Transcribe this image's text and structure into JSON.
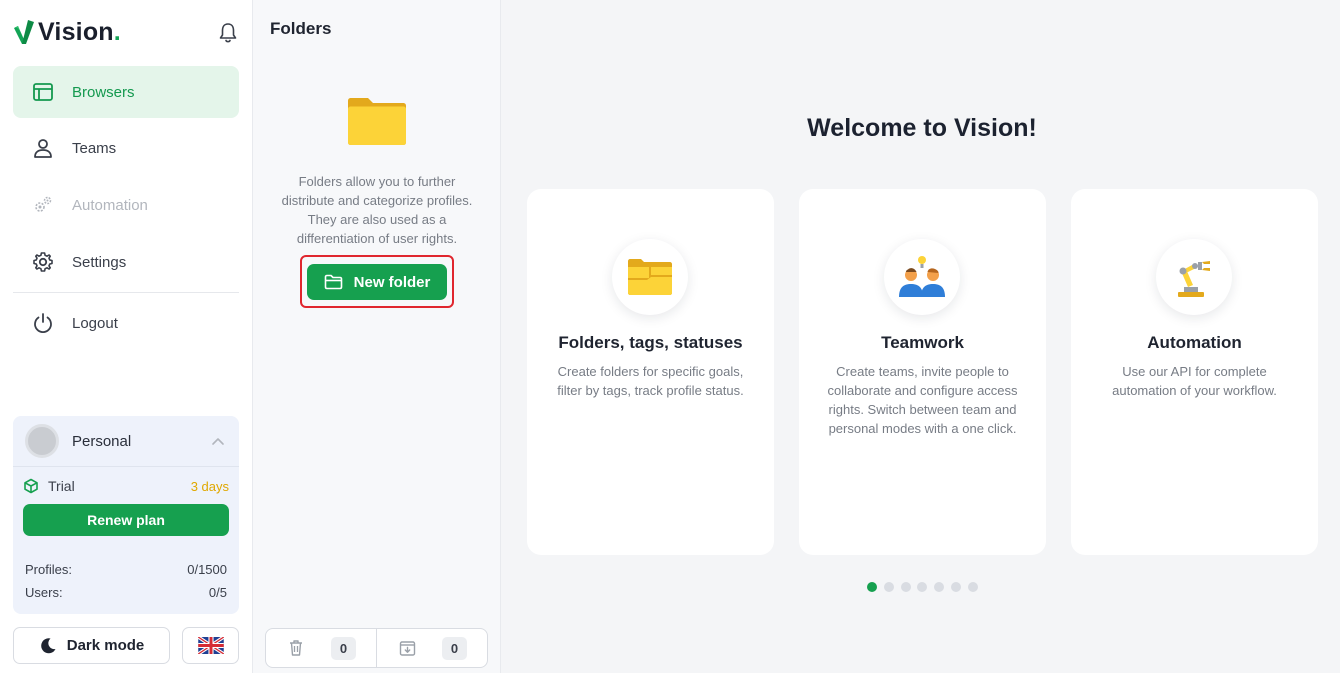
{
  "brand": {
    "name": "Vision",
    "dot": "."
  },
  "sidebar": {
    "items": [
      {
        "label": "Browsers",
        "icon": "browser-window-icon",
        "active": true
      },
      {
        "label": "Teams",
        "icon": "user-icon"
      },
      {
        "label": "Automation",
        "icon": "gears-icon",
        "disabled": true
      },
      {
        "label": "Settings",
        "icon": "gear-icon"
      },
      {
        "label": "Logout",
        "icon": "power-icon"
      }
    ]
  },
  "account": {
    "name": "Personal",
    "plan_label": "Trial",
    "plan_remaining": "3 days",
    "renew_label": "Renew plan",
    "profiles_label": "Profiles:",
    "profiles_value": "0/1500",
    "users_label": "Users:",
    "users_value": "0/5"
  },
  "footer": {
    "dark_mode_label": "Dark mode",
    "language_icon": "uk-flag-icon"
  },
  "folders": {
    "title": "Folders",
    "description": "Folders allow you to further distribute and categorize profiles. They are also used as a differentiation of user rights.",
    "new_folder_label": "New folder",
    "trash_count": "0",
    "archive_count": "0"
  },
  "main": {
    "welcome": "Welcome to Vision!",
    "cards": [
      {
        "title": "Folders, tags, statuses",
        "text": "Create folders for specific goals, filter by tags, track profile status.",
        "icon": "folders-icon"
      },
      {
        "title": "Teamwork",
        "text": "Create teams, invite people to collaborate and configure access rights. Switch between team and personal modes with a one click.",
        "icon": "team-icon"
      },
      {
        "title": "Automation",
        "text": "Use our API for complete automation of your workflow.",
        "icon": "robot-arm-icon"
      }
    ],
    "carousel": {
      "pages": 7,
      "active": 1
    }
  },
  "colors": {
    "accent": "#16a04f",
    "warning": "#e0a800",
    "highlight": "#e0262e"
  }
}
